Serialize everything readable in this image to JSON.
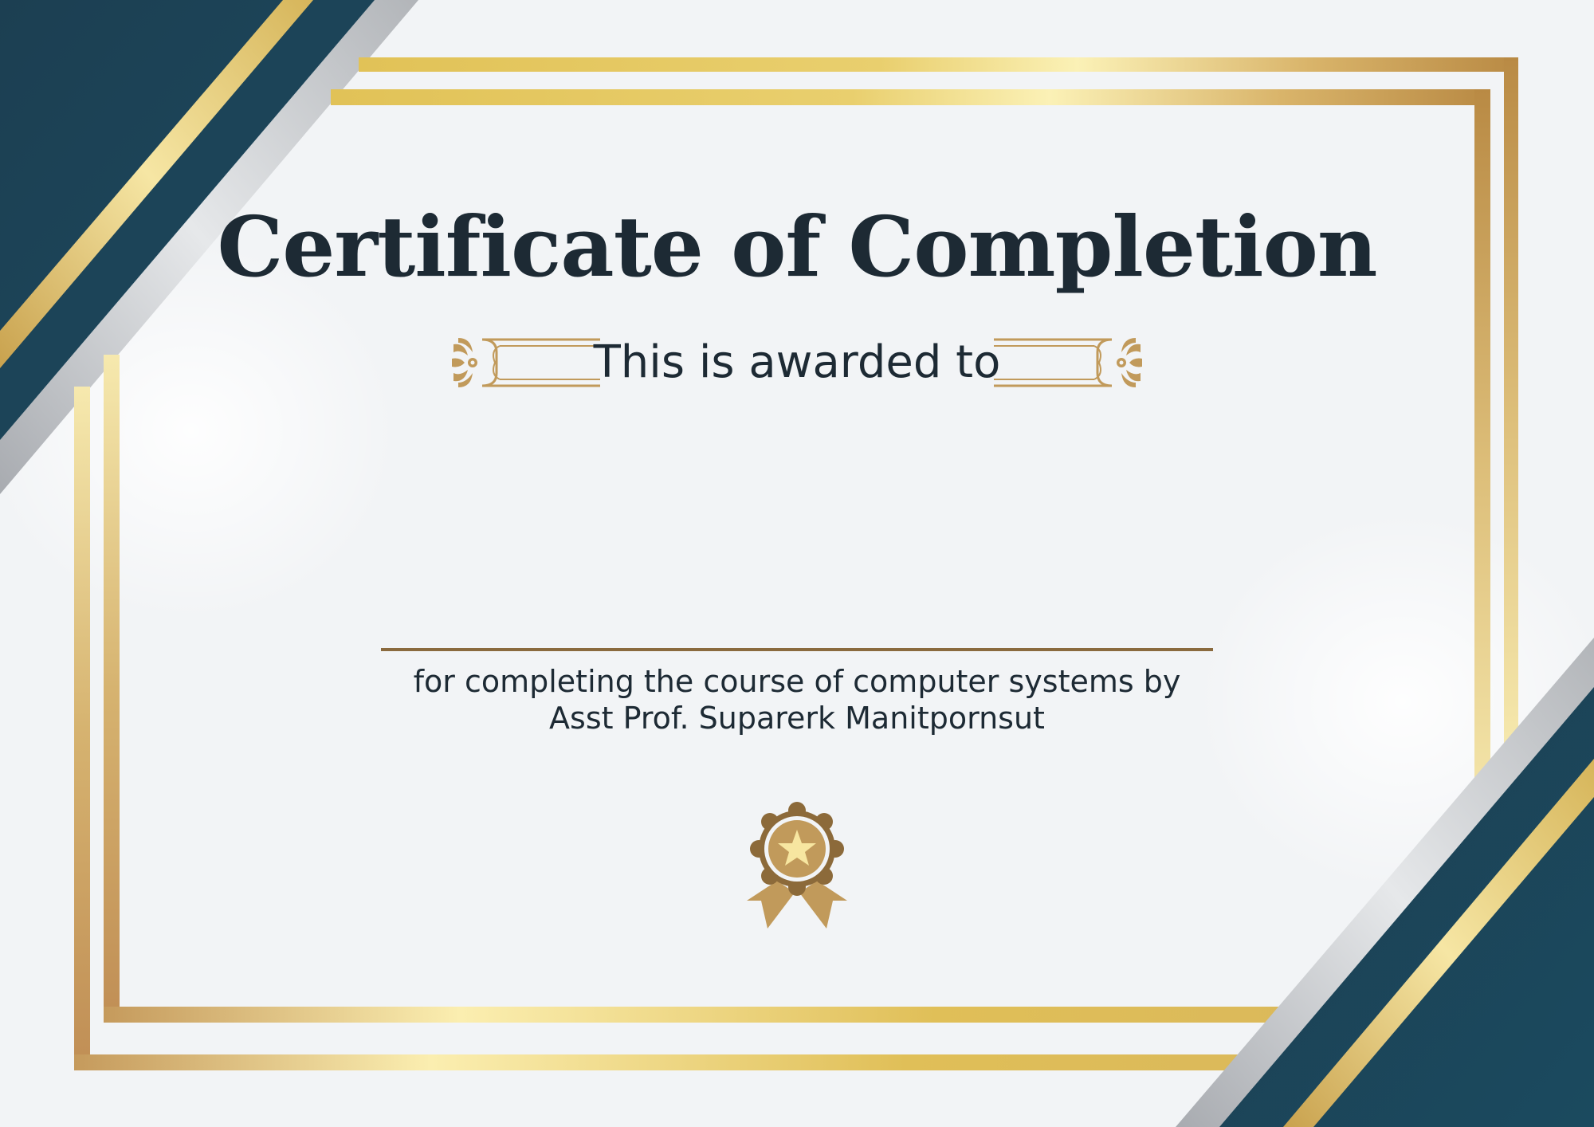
{
  "certificate": {
    "title": "Certificate of Completion",
    "awarded_text": "This is awarded to",
    "description_line1": "for completing the course of computer systems by",
    "description_line2": "Asst Prof. Suparerk Manitpornsut"
  },
  "colors": {
    "background": "#f2f4f6",
    "navy": "#1c4a5e",
    "gold": "#dcb95a",
    "gold_light": "#f8eaa8",
    "bronze": "#b98a52",
    "silver": "#b9bcc0",
    "text": "#1d2a34"
  },
  "icons": {
    "seal": "award-rosette-star-icon",
    "ornament": "flourish-scroll-icon"
  }
}
